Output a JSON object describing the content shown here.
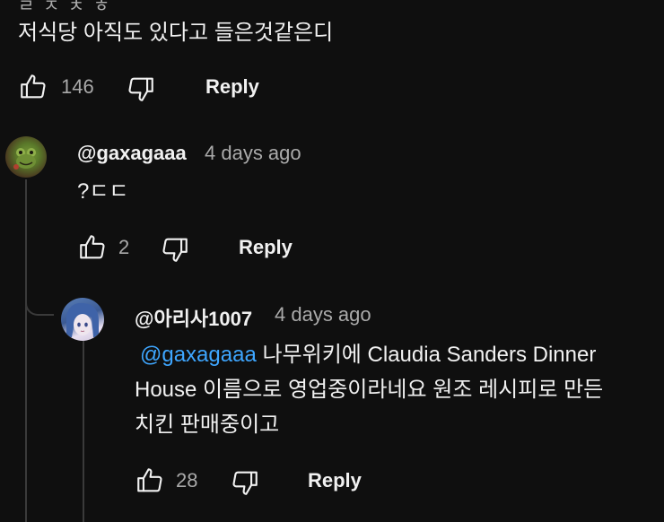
{
  "top_comment": {
    "truncated_header": "ㄹ ㅈ  ㅊ  ㅎ",
    "text": "저식당 아직도 있다고 들은것같은디",
    "likes": "146",
    "reply_label": "Reply"
  },
  "reply1": {
    "author": "@gaxagaaa",
    "time": "4 days ago",
    "text": "?ㄷㄷ",
    "likes": "2",
    "reply_label": "Reply"
  },
  "reply2": {
    "author": "@아리사1007",
    "time": "4 days ago",
    "mention": "@gaxagaaa",
    "line1": " 나무위키에 Claudia Sanders Dinner",
    "line2": "House 이름으로 영업중이라네요 원조 레시피로 만든",
    "line3": "치킨 판매중이고",
    "likes": "28",
    "reply_label": "Reply"
  },
  "colors": {
    "background": "#0f0f0f",
    "text": "#f1f1f1",
    "secondary": "#aaaaaa",
    "mention": "#3ea6ff"
  },
  "icons": [
    "thumb-up-icon",
    "thumb-down-icon"
  ]
}
